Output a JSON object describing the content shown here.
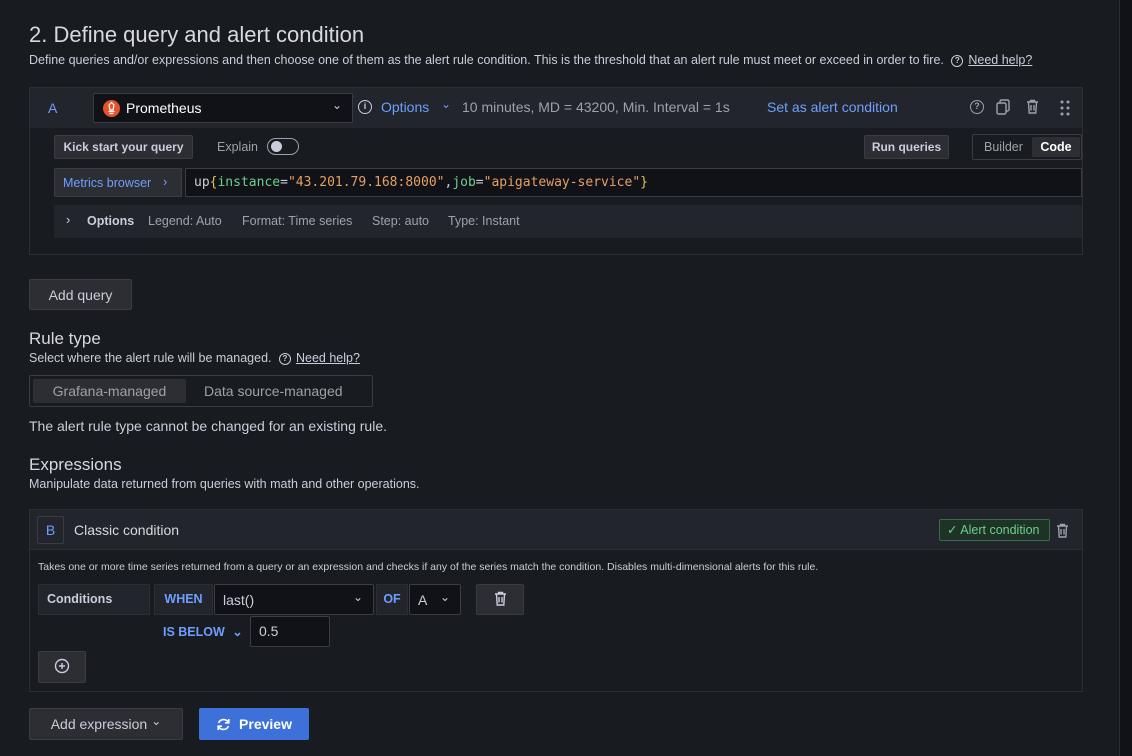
{
  "section": {
    "title": "2. Define query and alert condition",
    "description": "Define queries and/or expressions and then choose one of them as the alert rule condition. This is the threshold that an alert rule must meet or exceed in order to fire.",
    "help_link": "Need help?"
  },
  "query": {
    "ref_id": "A",
    "datasource": "Prometheus",
    "options_label": "Options",
    "options_summary": "10 minutes, MD = 43200, Min. Interval = 1s",
    "set_condition_label": "Set as alert condition",
    "kick_start_label": "Kick start your query",
    "explain_label": "Explain",
    "run_queries_label": "Run queries",
    "mode_builder": "Builder",
    "mode_code": "Code",
    "metrics_browser_label": "Metrics browser",
    "expr_metric": "up",
    "expr_open": "{",
    "expr_label1": "instance",
    "expr_eq1": "=",
    "expr_value1": "\"43.201.79.168:8000\"",
    "expr_comma": ",",
    "expr_label2": "job",
    "expr_eq2": "=",
    "expr_value2": "\"apigateway-service\"",
    "expr_close": "}",
    "opts_title": "Options",
    "opts_legend": "Legend: Auto",
    "opts_format": "Format: Time series",
    "opts_step": "Step: auto",
    "opts_type": "Type: Instant"
  },
  "add_query_label": "Add query",
  "rule_type": {
    "title": "Rule type",
    "description": "Select where the alert rule will be managed.",
    "help_link": "Need help?",
    "option_grafana": "Grafana-managed",
    "option_datasource": "Data source-managed",
    "note": "The alert rule type cannot be changed for an existing rule."
  },
  "expressions": {
    "title": "Expressions",
    "description": "Manipulate data returned from queries with math and other operations.",
    "card_ref": "B",
    "card_title": "Classic condition",
    "alert_badge": "Alert condition",
    "card_help": "Takes one or more time series returned from a query or an expression and checks if any of the series match the condition. Disables multi-dimensional alerts for this rule.",
    "conditions_label": "Conditions",
    "when_label": "WHEN",
    "reducer_value": "last()",
    "of_label": "OF",
    "query_ref": "A",
    "evaluator_label": "IS BELOW",
    "threshold_value": "0.5"
  },
  "add_expression_label": "Add expression",
  "preview_label": "Preview",
  "colors": {
    "background": "#181b1f",
    "accent_blue": "#3d71d9",
    "link_blue": "#6e9fff",
    "success_green": "#6ccf8e"
  }
}
